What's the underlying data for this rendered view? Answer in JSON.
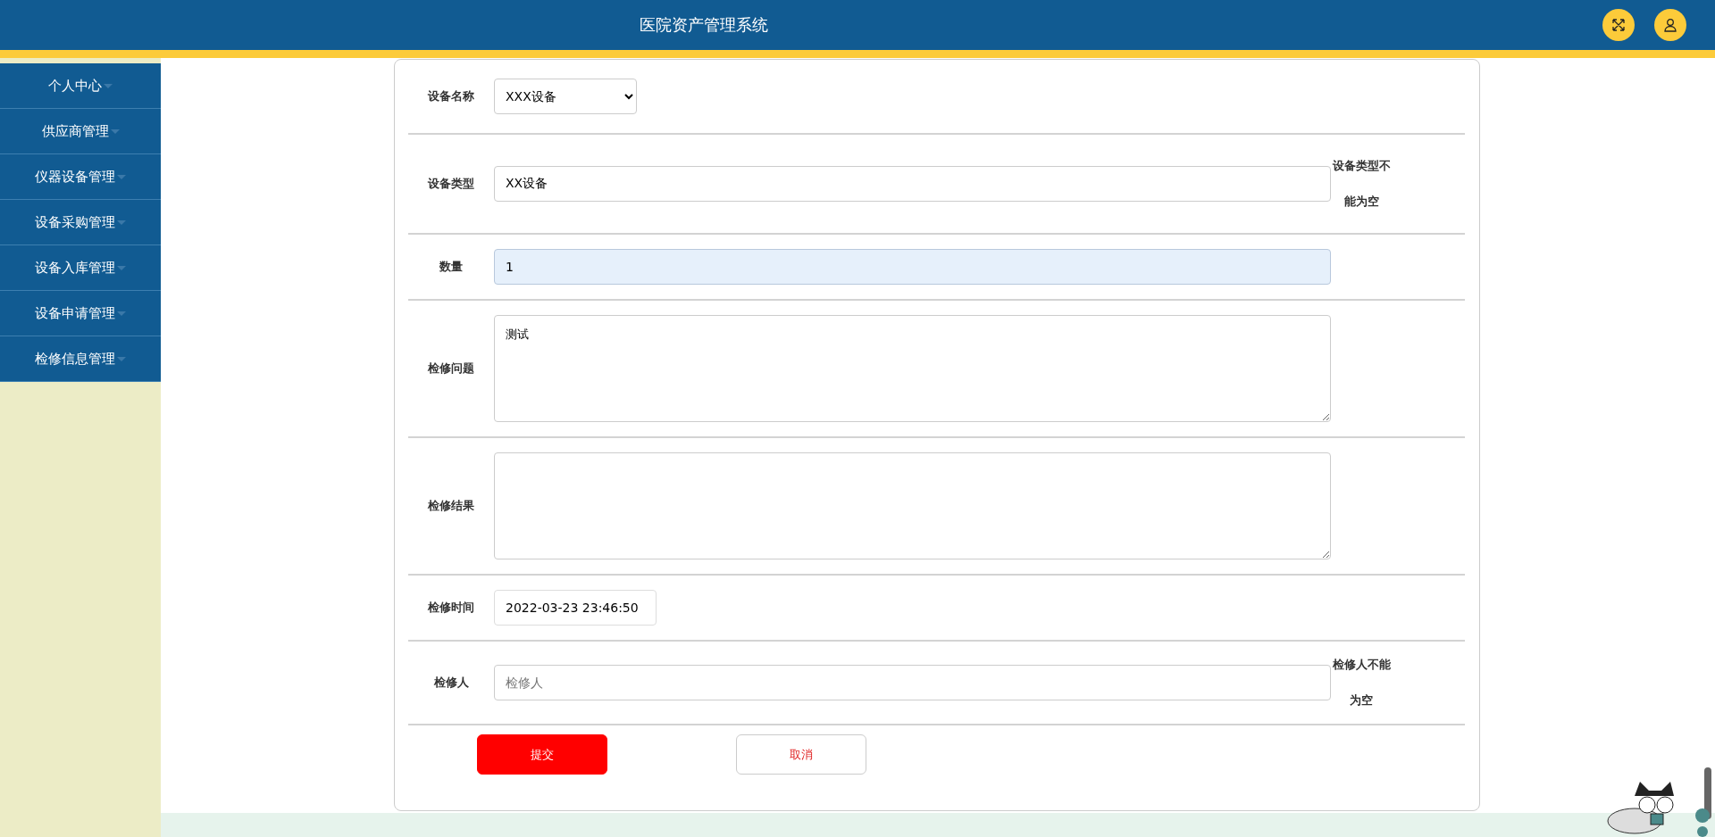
{
  "header": {
    "title": "医院资产管理系统"
  },
  "sidebar": {
    "items": [
      {
        "label": "个人中心"
      },
      {
        "label": "供应商管理"
      },
      {
        "label": "仪器设备管理"
      },
      {
        "label": "设备采购管理"
      },
      {
        "label": "设备入库管理"
      },
      {
        "label": "设备申请管理"
      },
      {
        "label": "检修信息管理"
      }
    ]
  },
  "form": {
    "fields": [
      {
        "kind": "select",
        "label": "设备名称",
        "value": "XXX设备",
        "highlighted": false
      },
      {
        "kind": "text",
        "label": "设备类型",
        "value": "XX设备",
        "error": "设备类型不能为空",
        "highlighted": false
      },
      {
        "kind": "text",
        "label": "数量",
        "value": "1",
        "highlighted": true
      },
      {
        "kind": "textarea",
        "label": "检修问题",
        "value": "测试",
        "highlighted": false
      },
      {
        "kind": "textarea",
        "label": "检修结果",
        "highlighted": false
      },
      {
        "kind": "datetime",
        "label": "检修时间",
        "value": "2022-03-23 23:46:50",
        "highlighted": false
      },
      {
        "kind": "text",
        "label": "检修人",
        "placeholder": "检修人",
        "error": "检修人不能为空",
        "highlighted": false
      }
    ],
    "buttons": [
      {
        "kind": "primary",
        "label": "提交"
      },
      {
        "kind": "secondary",
        "label": "取消"
      }
    ]
  }
}
